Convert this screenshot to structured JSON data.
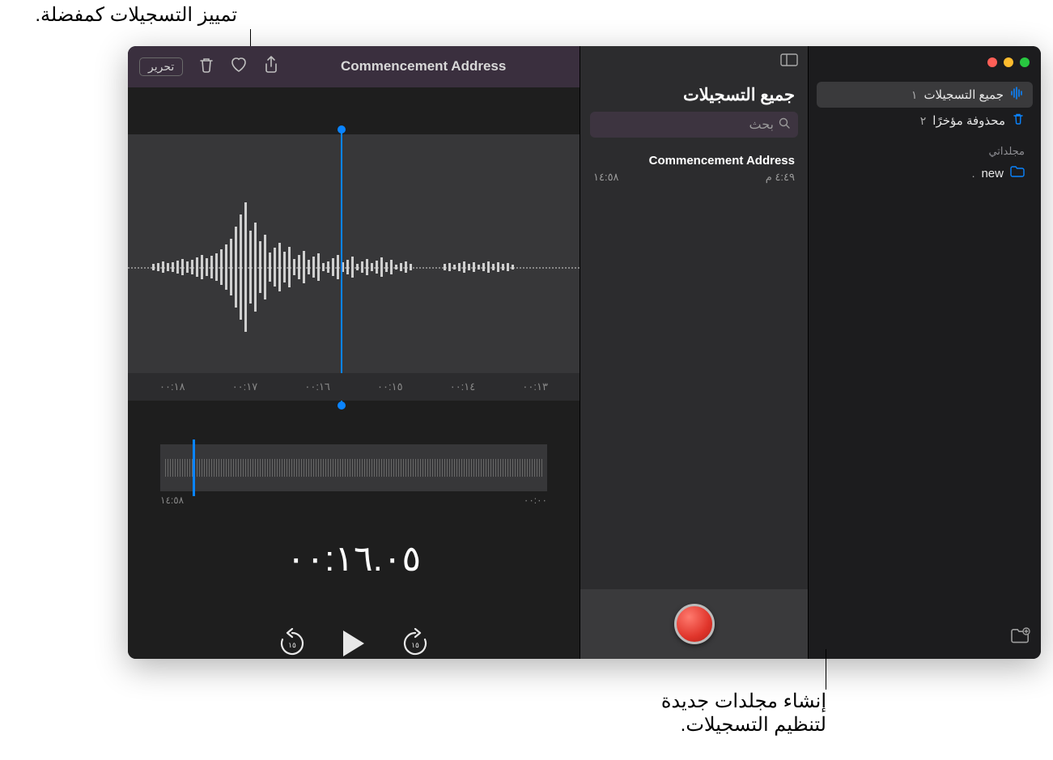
{
  "callouts": {
    "favorite": "تمييز التسجيلات كمفضلة.",
    "new_folder_line1": "إنشاء مجلدات جديدة",
    "new_folder_line2": "لتنظيم التسجيلات."
  },
  "sidebar": {
    "items": [
      {
        "label": "جميع التسجيلات",
        "count": "١",
        "icon": "waveform-icon"
      },
      {
        "label": "محذوفة مؤخرًا",
        "count": "٢",
        "icon": "trash-icon"
      }
    ],
    "my_folders_label": "مجلداتي",
    "folders": [
      {
        "label": "new",
        "count": ".",
        "icon": "folder-icon"
      }
    ]
  },
  "middle": {
    "header": "جميع التسجيلات",
    "search_placeholder": "بحث",
    "recording": {
      "title": "Commencement Address",
      "time": "٤:٤٩ م",
      "duration": "١٤:٥٨"
    }
  },
  "toolbar": {
    "title": "Commencement Address",
    "edit_label": "تحرير"
  },
  "ruler": {
    "t0": "٠٠:١٣",
    "t1": "٠٠:١٤",
    "t2": "٠٠:١٥",
    "t3": "٠٠:١٦",
    "t4": "٠٠:١٧",
    "t5": "٠٠:١٨"
  },
  "overview": {
    "start": "٠٠:٠٠",
    "end": "١٤:٥٨"
  },
  "playback": {
    "current_time": "٠٠:١٦.٠٥",
    "skip_back": "١٥",
    "skip_fwd": "١٥"
  },
  "colors": {
    "accent": "#0a84ff",
    "record": "#ff3b30"
  }
}
